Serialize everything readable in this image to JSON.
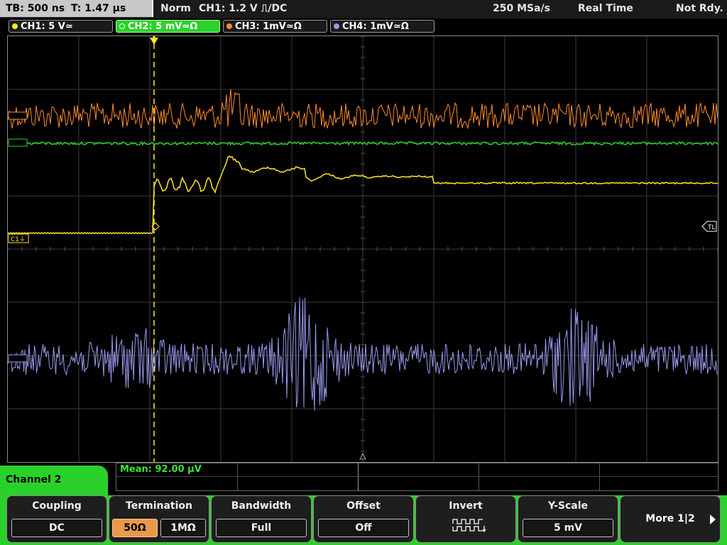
{
  "status_bar": {
    "timebase": "TB: 500 ns",
    "trigger_time": "T: 1.47 µs",
    "trigger_mode": "Norm",
    "trigger_info": "CH1: 1.2 V ⎍/DC",
    "sample_rate": "250 MSa/s",
    "acq_mode": "Real Time",
    "state": "Not Rdy."
  },
  "channels": [
    {
      "label": "CH1: 5 V≃",
      "color": "#ffe629"
    },
    {
      "label": "CH2: 5 mV≃Ω",
      "color": "#2bd12b",
      "active": true
    },
    {
      "label": "CH3: 1mV≃Ω",
      "color": "#ff8c2a"
    },
    {
      "label": "CH4: 1mV≃Ω",
      "color": "#9999ee"
    }
  ],
  "markers": {
    "ch1_ground": "C1⏚",
    "trigger_level": "TL"
  },
  "measurement": {
    "text": "Mean: 92.00 µV"
  },
  "menu": {
    "title": "Channel 2",
    "softkeys": {
      "coupling": {
        "title": "Coupling",
        "value": "DC"
      },
      "termination": {
        "title": "Termination",
        "opt1": "50Ω",
        "opt2": "1MΩ",
        "selected": "50Ω"
      },
      "bandwidth": {
        "title": "Bandwidth",
        "value": "Full"
      },
      "offset": {
        "title": "Offset",
        "value": "Off"
      },
      "invert": {
        "title": "Invert"
      },
      "yscale": {
        "title": "Y-Scale",
        "value": "5 mV"
      },
      "more": {
        "label": "More 1|2"
      }
    }
  },
  "colors": {
    "ch1": "#ffe629",
    "ch2": "#2bd12b",
    "ch3": "#ff8c2a",
    "ch4": "#9999ee",
    "menu_accent": "#2bd12b",
    "selected_option": "#e89a4a"
  }
}
